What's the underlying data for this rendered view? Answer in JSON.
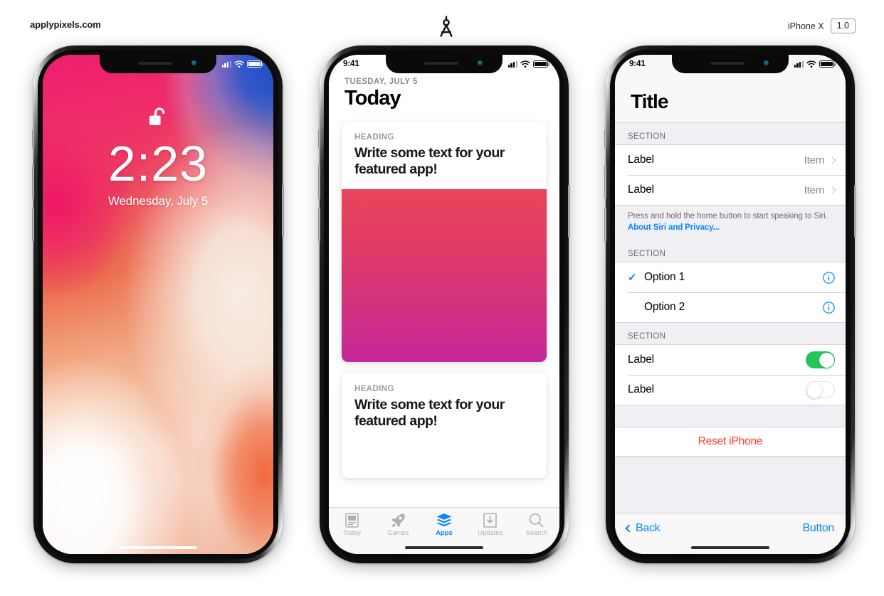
{
  "header": {
    "brand": "applypixels.com",
    "logo_icon": "compass-divider-logo",
    "device_label": "iPhone X",
    "version_badge": "1.0"
  },
  "phone1": {
    "name": "lock-screen",
    "status_bar": {
      "time": "",
      "icons": [
        "cellular-signal-icon",
        "wifi-icon",
        "battery-icon"
      ]
    },
    "lock_icon": "unlocked-padlock-icon",
    "time": "2:23",
    "date": "Wednesday, July 5",
    "wallpaper_colors": {
      "pink": "#ef1d6e",
      "blue": "#1f4ec4",
      "orange": "#f2693f",
      "cream": "#f7ece5"
    }
  },
  "phone2": {
    "name": "today-app",
    "status_bar": {
      "time": "9:41",
      "icons": [
        "cellular-signal-icon",
        "wifi-icon",
        "battery-icon"
      ]
    },
    "kicker": "TUESDAY, JULY 5",
    "title": "Today",
    "cards": [
      {
        "kicker": "HEADING",
        "headline": "Write some text for your featured app!",
        "has_image": true
      },
      {
        "kicker": "HEADING",
        "headline": "Write some text for your featured app!",
        "has_image": false
      }
    ],
    "image_gradient": {
      "top": "#e8465a",
      "bottom": "#c5289a"
    },
    "tabs": [
      {
        "label": "Today",
        "icon": "newspaper-icon",
        "active": false
      },
      {
        "label": "Games",
        "icon": "rocket-icon",
        "active": false
      },
      {
        "label": "Apps",
        "icon": "layers-icon",
        "active": true
      },
      {
        "label": "Updates",
        "icon": "download-icon",
        "active": false
      },
      {
        "label": "Search",
        "icon": "search-icon",
        "active": false
      }
    ],
    "accent_color": "#0a84ff"
  },
  "phone3": {
    "name": "settings-table",
    "status_bar": {
      "time": "9:41",
      "icons": [
        "cellular-signal-icon",
        "wifi-icon",
        "battery-icon"
      ]
    },
    "title": "Title",
    "sections": [
      {
        "header": "SECTION",
        "rows": [
          {
            "label": "Label",
            "value": "Item",
            "accessory": "chevron-right-icon"
          },
          {
            "label": "Label",
            "value": "Item",
            "accessory": "chevron-right-icon"
          }
        ],
        "footnote_text": "Press and hold the home button to start speaking to Siri. ",
        "footnote_link": "About Siri and Privacy..."
      },
      {
        "header": "SECTION",
        "rows": [
          {
            "label": "Option 1",
            "checked": true,
            "accessory": "info-circle-icon"
          },
          {
            "label": "Option 2",
            "checked": false,
            "accessory": "info-circle-icon"
          }
        ]
      },
      {
        "header": "SECTION",
        "rows": [
          {
            "label": "Label",
            "toggle": "on"
          },
          {
            "label": "Label",
            "toggle": "off"
          }
        ]
      }
    ],
    "action": {
      "label": "Reset iPhone",
      "color": "#ff3b30"
    },
    "toolbar": {
      "back_label": "Back",
      "back_icon": "chevron-left-icon",
      "button_label": "Button"
    },
    "toggle_on_color": "#22c65b",
    "accent_color": "#0a84ff"
  }
}
